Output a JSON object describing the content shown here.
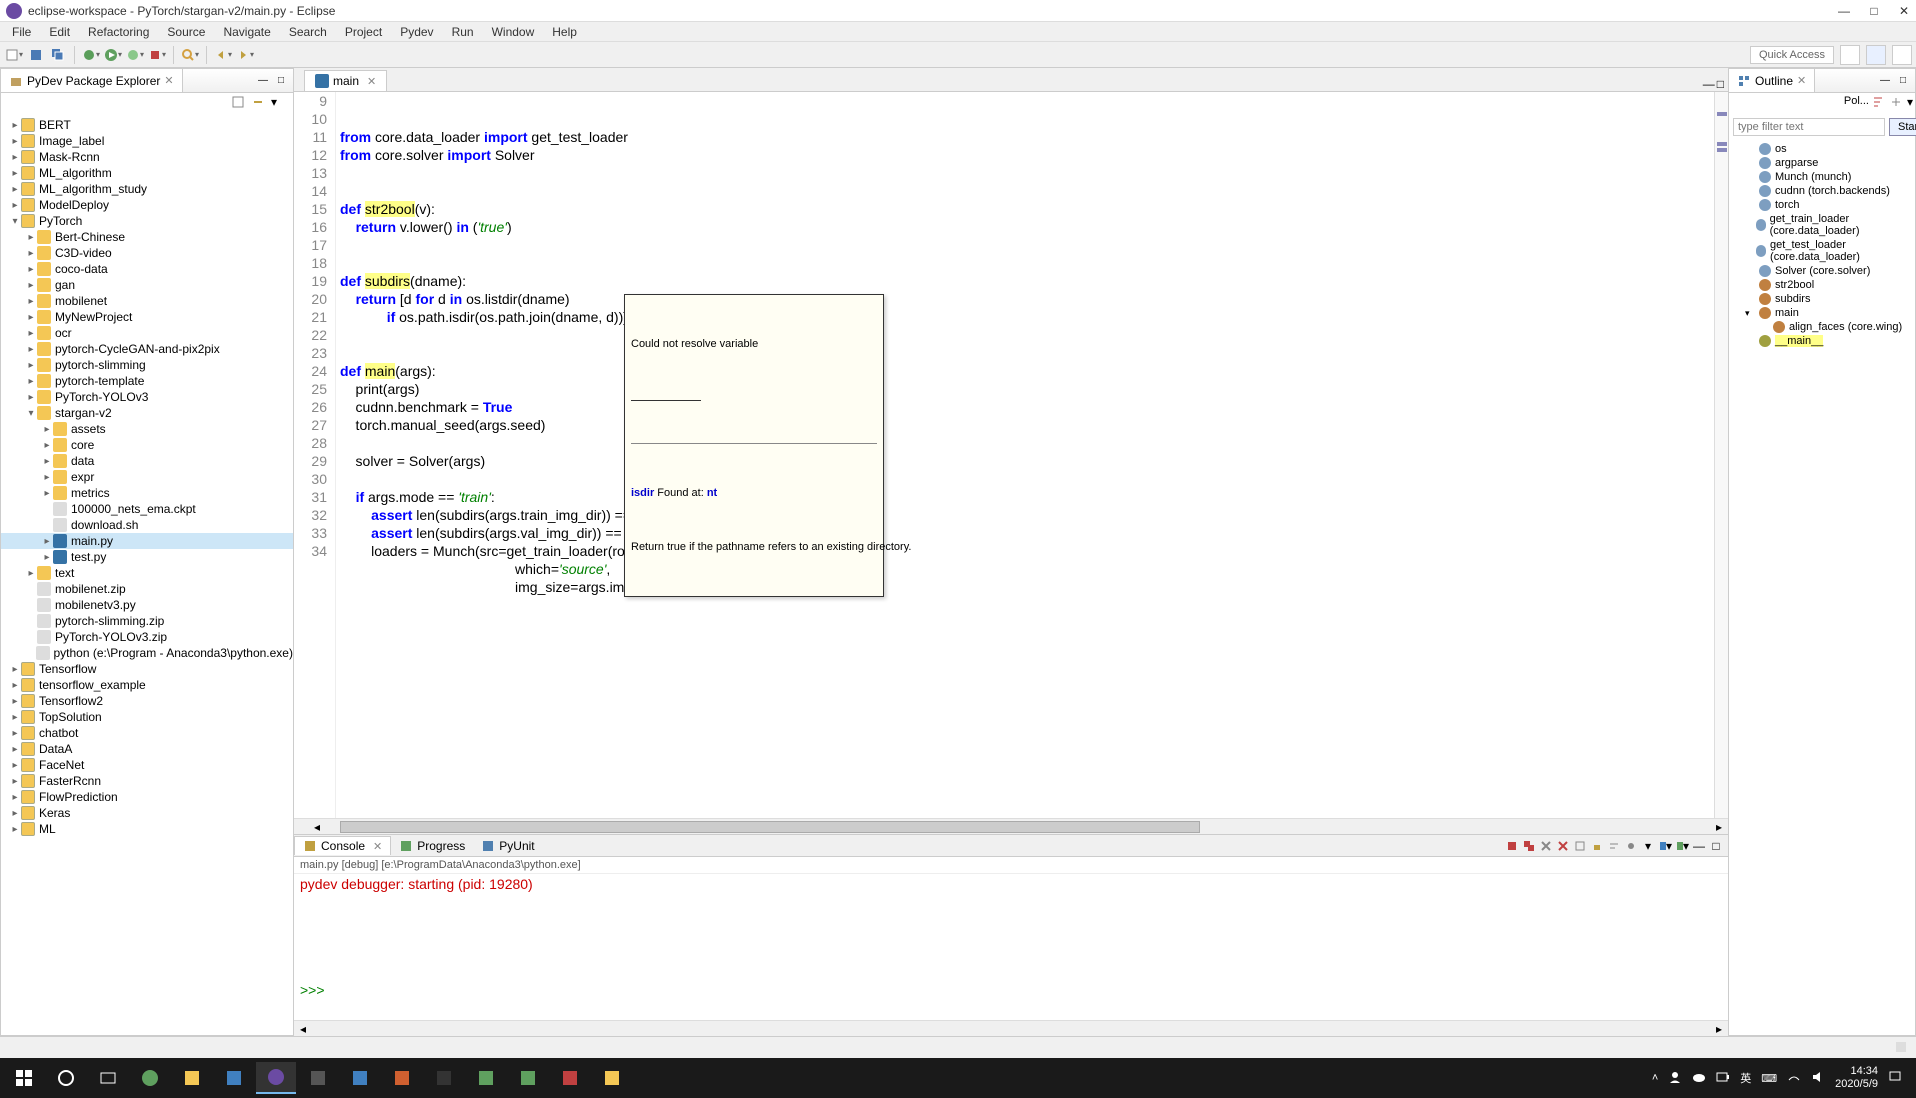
{
  "window": {
    "title": "eclipse-workspace - PyTorch/stargan-v2/main.py - Eclipse"
  },
  "menu": [
    "File",
    "Edit",
    "Refactoring",
    "Source",
    "Navigate",
    "Search",
    "Project",
    "Pydev",
    "Run",
    "Window",
    "Help"
  ],
  "quick_access": "Quick Access",
  "explorer": {
    "title": "PyDev Package Explorer",
    "items": [
      {
        "depth": 0,
        "toggle": "▸",
        "type": "proj",
        "label": "BERT"
      },
      {
        "depth": 0,
        "toggle": "▸",
        "type": "proj",
        "label": "Image_label"
      },
      {
        "depth": 0,
        "toggle": "▸",
        "type": "proj",
        "label": "Mask-Rcnn"
      },
      {
        "depth": 0,
        "toggle": "▸",
        "type": "proj",
        "label": "ML_algorithm"
      },
      {
        "depth": 0,
        "toggle": "▸",
        "type": "proj",
        "label": "ML_algorithm_study"
      },
      {
        "depth": 0,
        "toggle": "▸",
        "type": "proj",
        "label": "ModelDeploy"
      },
      {
        "depth": 0,
        "toggle": "▾",
        "type": "proj",
        "label": "PyTorch"
      },
      {
        "depth": 1,
        "toggle": "▸",
        "type": "folder",
        "label": "Bert-Chinese"
      },
      {
        "depth": 1,
        "toggle": "▸",
        "type": "folder",
        "label": "C3D-video"
      },
      {
        "depth": 1,
        "toggle": "▸",
        "type": "folder",
        "label": "coco-data"
      },
      {
        "depth": 1,
        "toggle": "▸",
        "type": "folder",
        "label": "gan"
      },
      {
        "depth": 1,
        "toggle": "▸",
        "type": "folder",
        "label": "mobilenet"
      },
      {
        "depth": 1,
        "toggle": "▸",
        "type": "folder",
        "label": "MyNewProject"
      },
      {
        "depth": 1,
        "toggle": "▸",
        "type": "folder",
        "label": "ocr"
      },
      {
        "depth": 1,
        "toggle": "▸",
        "type": "folder",
        "label": "pytorch-CycleGAN-and-pix2pix"
      },
      {
        "depth": 1,
        "toggle": "▸",
        "type": "folder",
        "label": "pytorch-slimming"
      },
      {
        "depth": 1,
        "toggle": "▸",
        "type": "folder",
        "label": "pytorch-template"
      },
      {
        "depth": 1,
        "toggle": "▸",
        "type": "folder",
        "label": "PyTorch-YOLOv3"
      },
      {
        "depth": 1,
        "toggle": "▾",
        "type": "folder",
        "label": "stargan-v2"
      },
      {
        "depth": 2,
        "toggle": "▸",
        "type": "folder",
        "label": "assets"
      },
      {
        "depth": 2,
        "toggle": "▸",
        "type": "folder",
        "label": "core"
      },
      {
        "depth": 2,
        "toggle": "▸",
        "type": "folder",
        "label": "data"
      },
      {
        "depth": 2,
        "toggle": "▸",
        "type": "folder",
        "label": "expr"
      },
      {
        "depth": 2,
        "toggle": "▸",
        "type": "folder",
        "label": "metrics"
      },
      {
        "depth": 2,
        "toggle": " ",
        "type": "file",
        "label": "100000_nets_ema.ckpt"
      },
      {
        "depth": 2,
        "toggle": " ",
        "type": "file",
        "label": "download.sh"
      },
      {
        "depth": 2,
        "toggle": "▸",
        "type": "py",
        "label": "main.py",
        "selected": true
      },
      {
        "depth": 2,
        "toggle": "▸",
        "type": "py",
        "label": "test.py"
      },
      {
        "depth": 1,
        "toggle": "▸",
        "type": "folder",
        "label": "text"
      },
      {
        "depth": 1,
        "toggle": " ",
        "type": "file",
        "label": "mobilenet.zip"
      },
      {
        "depth": 1,
        "toggle": " ",
        "type": "file",
        "label": "mobilenetv3.py"
      },
      {
        "depth": 1,
        "toggle": " ",
        "type": "file",
        "label": "pytorch-slimming.zip"
      },
      {
        "depth": 1,
        "toggle": " ",
        "type": "file",
        "label": "PyTorch-YOLOv3.zip"
      },
      {
        "depth": 1,
        "toggle": " ",
        "type": "file",
        "label": "python (e:\\Program - Anaconda3\\python.exe)"
      },
      {
        "depth": 0,
        "toggle": "▸",
        "type": "proj",
        "label": "Tensorflow"
      },
      {
        "depth": 0,
        "toggle": "▸",
        "type": "proj",
        "label": "tensorflow_example"
      },
      {
        "depth": 0,
        "toggle": "▸",
        "type": "proj",
        "label": "Tensorflow2"
      },
      {
        "depth": 0,
        "toggle": "▸",
        "type": "proj",
        "label": "TopSolution"
      },
      {
        "depth": 0,
        "toggle": "▸",
        "type": "proj",
        "label": "chatbot"
      },
      {
        "depth": 0,
        "toggle": "▸",
        "type": "proj",
        "label": "DataA"
      },
      {
        "depth": 0,
        "toggle": "▸",
        "type": "proj",
        "label": "FaceNet"
      },
      {
        "depth": 0,
        "toggle": "▸",
        "type": "proj",
        "label": "FasterRcnn"
      },
      {
        "depth": 0,
        "toggle": "▸",
        "type": "proj",
        "label": "FlowPrediction"
      },
      {
        "depth": 0,
        "toggle": "▸",
        "type": "proj",
        "label": "Keras"
      },
      {
        "depth": 0,
        "toggle": "▸",
        "type": "proj",
        "label": "ML"
      }
    ]
  },
  "editor": {
    "tab": "main",
    "lines": [
      {
        "n": 9,
        "html": "<span class='kw'>from</span> core.data_loader <span class='kw'>import</span> get_test_loader"
      },
      {
        "n": 10,
        "html": "<span class='kw'>from</span> core.solver <span class='kw'>import</span> Solver"
      },
      {
        "n": 11,
        "html": ""
      },
      {
        "n": 12,
        "html": ""
      },
      {
        "n": 13,
        "html": "<span class='kw'>def</span> <span class='hl'>str2bool</span>(v):"
      },
      {
        "n": 14,
        "html": "    <span class='kw'>return</span> v.lower() <span class='kw'>in</span> (<span class='str'>'true'</span>)"
      },
      {
        "n": 15,
        "html": ""
      },
      {
        "n": 16,
        "html": ""
      },
      {
        "n": 17,
        "html": "<span class='kw'>def</span> <span class='hl'>subdirs</span>(dname):"
      },
      {
        "n": 18,
        "html": "    <span class='kw'>return</span> [d <span class='kw'>for</span> d <span class='kw'>in</span> os.listdir(dname)"
      },
      {
        "n": 19,
        "html": "            <span class='kw'>if</span> os.path.isdir(os.path.join(dname, d))]"
      },
      {
        "n": 20,
        "html": ""
      },
      {
        "n": 21,
        "html": ""
      },
      {
        "n": 22,
        "html": "<span class='kw'>def</span> <span class='hl'>main</span>(args):"
      },
      {
        "n": 23,
        "html": "    print(args)"
      },
      {
        "n": 24,
        "html": "    cudnn.benchmark = <span class='kw'>True</span>"
      },
      {
        "n": 25,
        "html": "    torch.manual_seed(args.seed)"
      },
      {
        "n": 26,
        "html": ""
      },
      {
        "n": 27,
        "html": "    solver = Solver(args)"
      },
      {
        "n": 28,
        "html": ""
      },
      {
        "n": 29,
        "html": "    <span class='kw'>if</span> args.mode == <span class='str'>'train'</span>:"
      },
      {
        "n": 30,
        "html": "        <span class='kw'>assert</span> len(subdirs(args.train_img_dir)) == args.num_domains"
      },
      {
        "n": 31,
        "html": "        <span class='kw'>assert</span> len(subdirs(args.val_img_dir)) == args.num_domains"
      },
      {
        "n": 32,
        "html": "        loaders = Munch(src=get_train_loader(root=args.train_img_dir,"
      },
      {
        "n": 33,
        "html": "                                             which=<span class='str'>'source'</span>,"
      },
      {
        "n": 34,
        "html": "                                             img_size=args.img_size,"
      }
    ],
    "tooltip": {
      "line1": "Could not resolve variable",
      "fn": "isdir",
      "found": " Found at: ",
      "mod": "nt",
      "desc": "Return true if the pathname refers to an existing directory."
    }
  },
  "console": {
    "tabs": [
      "Console",
      "Progress",
      "PyUnit"
    ],
    "label": "main.py [debug] [e:\\ProgramData\\Anaconda3\\python.exe]",
    "out1": "pydev debugger: starting (pid: 19280)",
    "prompt": ">>> "
  },
  "outline": {
    "title": "Outline",
    "filter_placeholder": "type filter text",
    "pol": "Pol...",
    "start": "Start",
    "items": [
      {
        "type": "import",
        "label": "os"
      },
      {
        "type": "import",
        "label": "argparse"
      },
      {
        "type": "import",
        "label": "Munch (munch)"
      },
      {
        "type": "import",
        "label": "cudnn (torch.backends)"
      },
      {
        "type": "import",
        "label": "torch"
      },
      {
        "type": "import",
        "label": "get_train_loader (core.data_loader)"
      },
      {
        "type": "import",
        "label": "get_test_loader (core.data_loader)"
      },
      {
        "type": "import",
        "label": "Solver (core.solver)"
      },
      {
        "type": "func",
        "label": "str2bool"
      },
      {
        "type": "func",
        "label": "subdirs"
      },
      {
        "type": "func",
        "label": "main",
        "expand": true
      },
      {
        "type": "func",
        "label": "align_faces (core.wing)",
        "indent": 1
      },
      {
        "type": "var",
        "label": "__main__",
        "hl": true
      }
    ]
  },
  "tray": {
    "time": "14:34",
    "date": "2020/5/9"
  }
}
